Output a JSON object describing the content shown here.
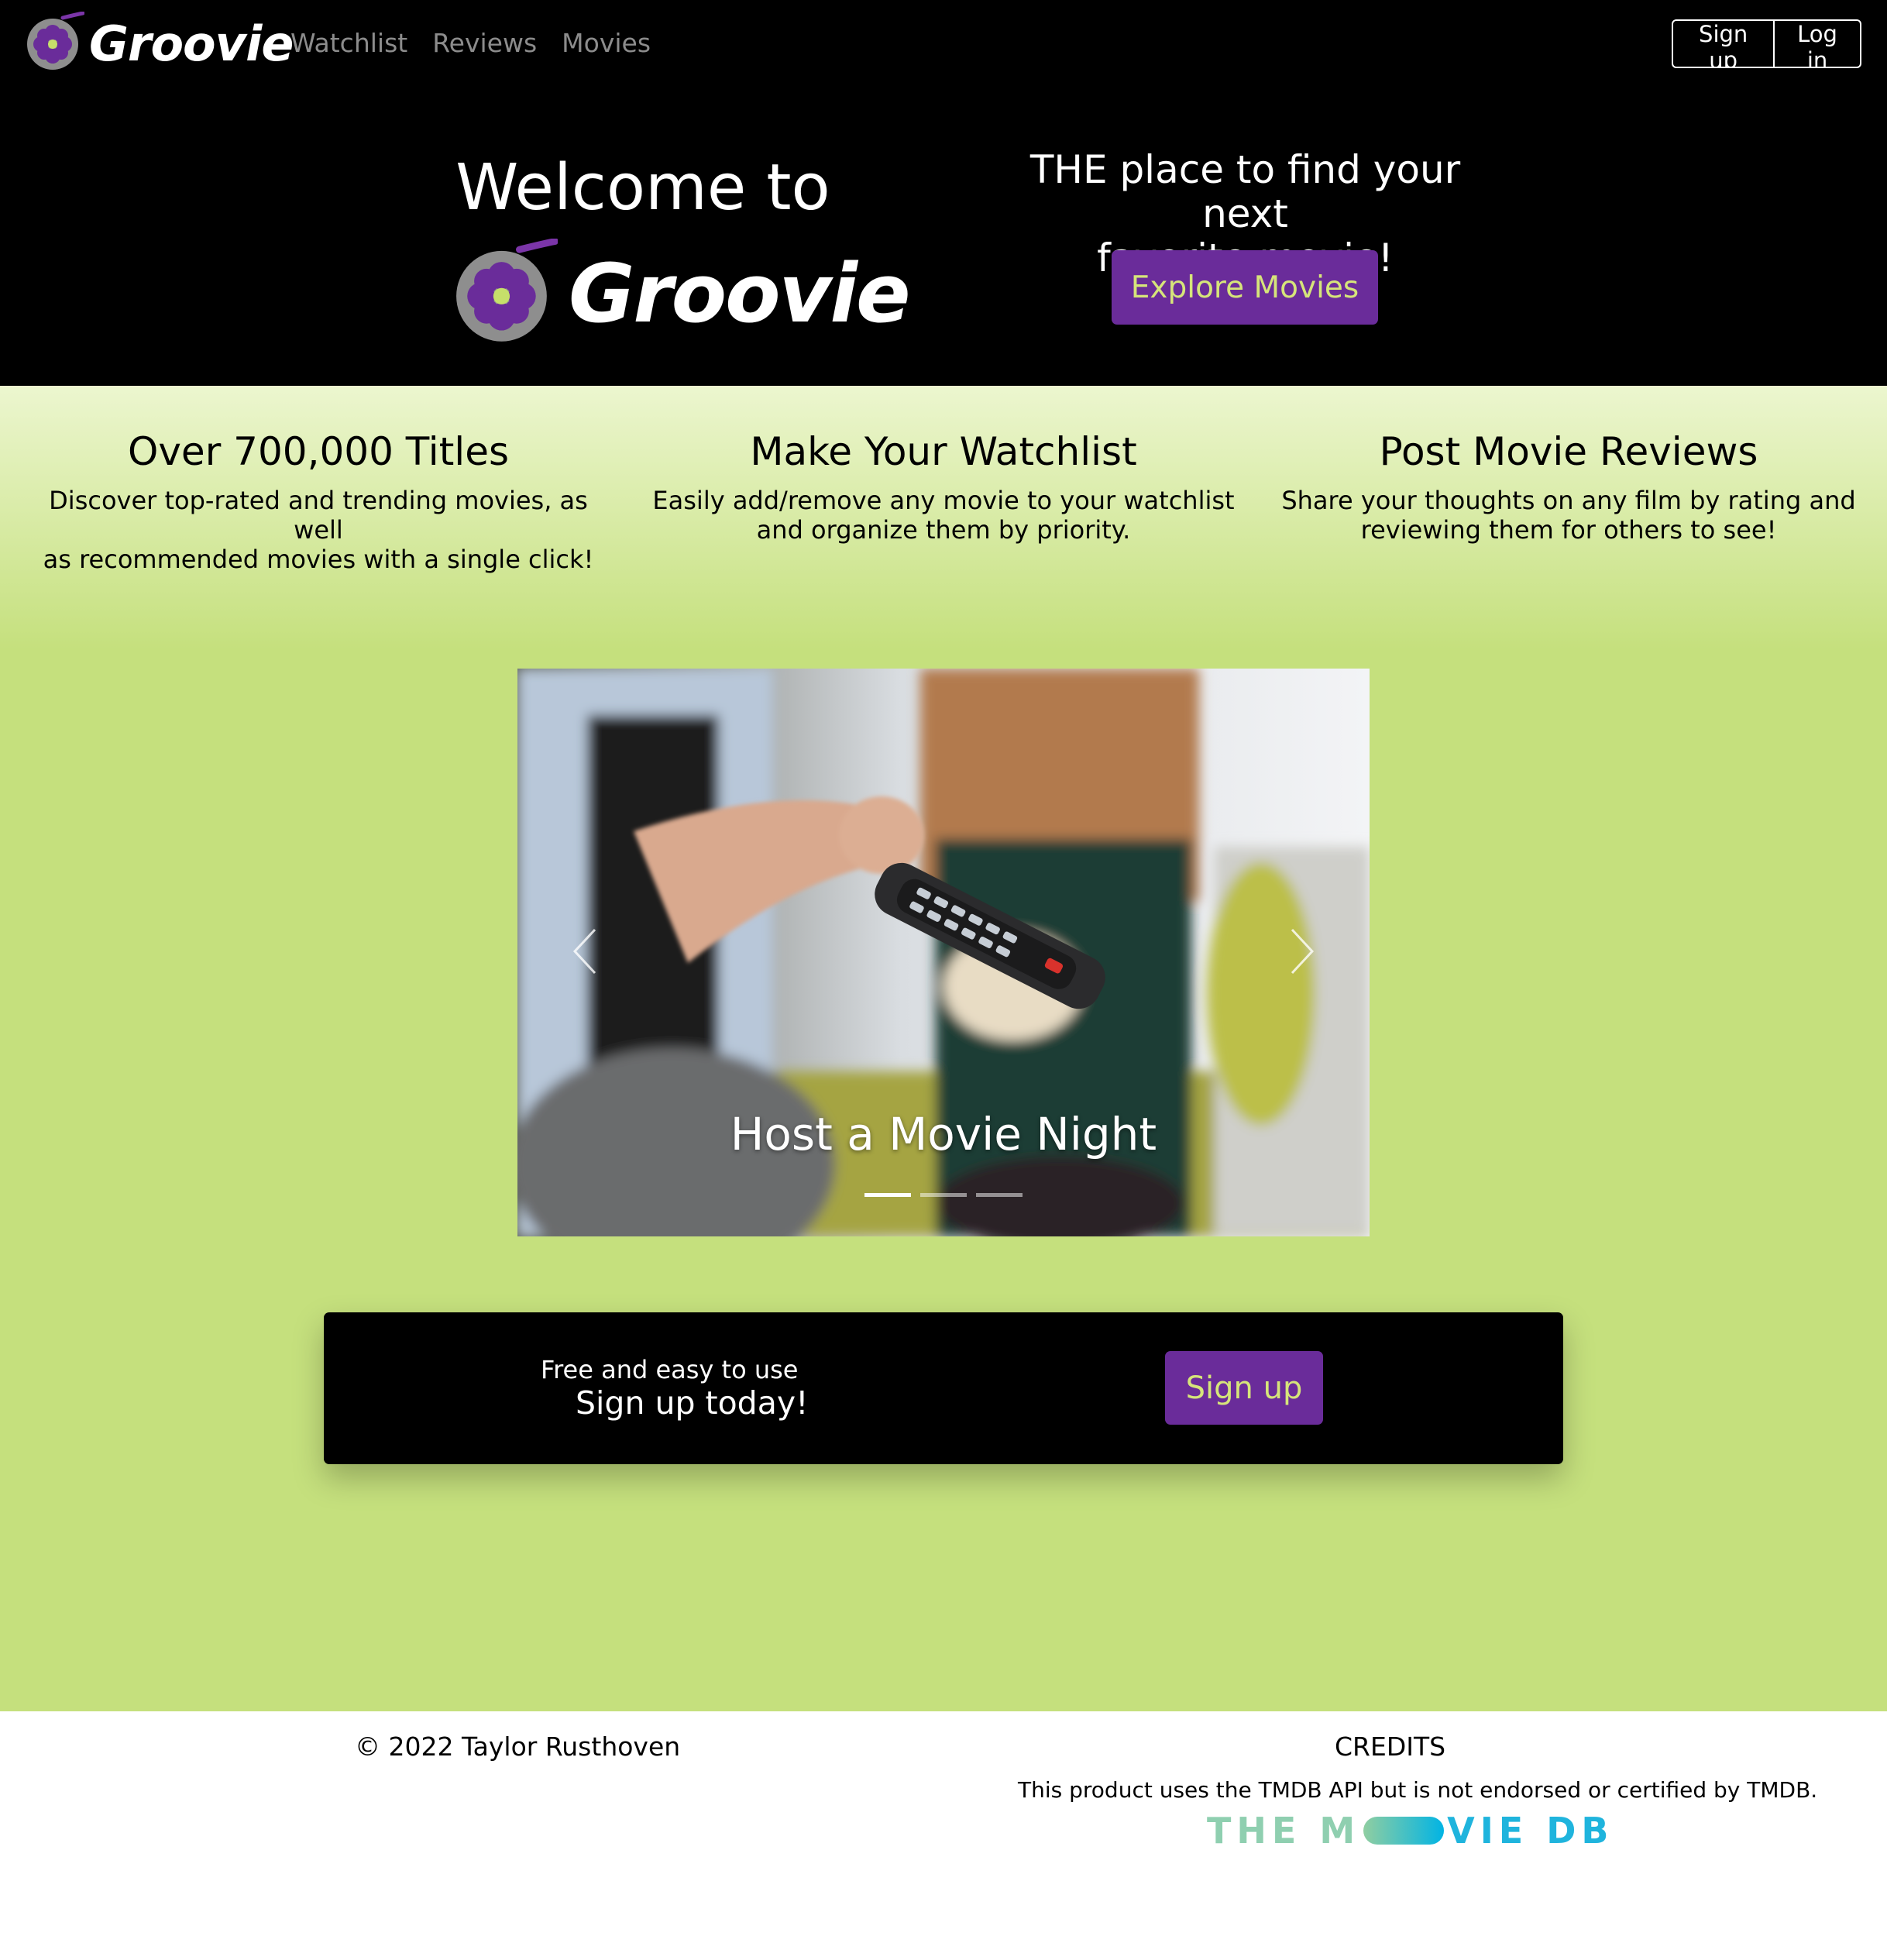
{
  "brand": {
    "name": "Groovie"
  },
  "nav": {
    "links": [
      "Watchlist",
      "Reviews",
      "Movies"
    ]
  },
  "auth": {
    "signup": "Sign up",
    "login": "Log in"
  },
  "hero": {
    "welcome": "Welcome to",
    "brand": "Groovie",
    "tagline_line1": "THE place to find your next",
    "tagline_line2": "favorite movie!",
    "cta": "Explore Movies"
  },
  "features": [
    {
      "title": "Over 700,000 Titles",
      "line1": "Discover top-rated and trending movies, as well",
      "line2": "as recommended movies with a single click!"
    },
    {
      "title": "Make Your Watchlist",
      "line1": "Easily add/remove any movie to your watchlist",
      "line2": "and organize them by priority."
    },
    {
      "title": "Post Movie Reviews",
      "line1": "Share your thoughts on any film by rating and",
      "line2": "reviewing them for others to see!"
    }
  ],
  "carousel": {
    "caption": "Host a Movie Night",
    "slide_count": 3,
    "active_index": 0
  },
  "signup_cta": {
    "small": "Free and easy to use",
    "big": "Sign up today!",
    "button": "Sign up"
  },
  "footer": {
    "copyright": "© 2022 Taylor Rusthoven",
    "credits_title": "CREDITS",
    "credits_text": "This product uses the TMDB API but is not endorsed or certified by TMDB.",
    "tmdb_logo_left": "THE M",
    "tmdb_logo_right": "VIE DB"
  },
  "colors": {
    "navbar_bg": "#000000",
    "accent_purple": "#6a2c9a",
    "accent_lime_text": "#d6e57a",
    "main_green": "#c5e07d",
    "nav_link": "#8c8c8c"
  },
  "icons": {
    "logo": "purple-flower-film-reel-icon",
    "prev": "chevron-left-icon",
    "next": "chevron-right-icon"
  }
}
